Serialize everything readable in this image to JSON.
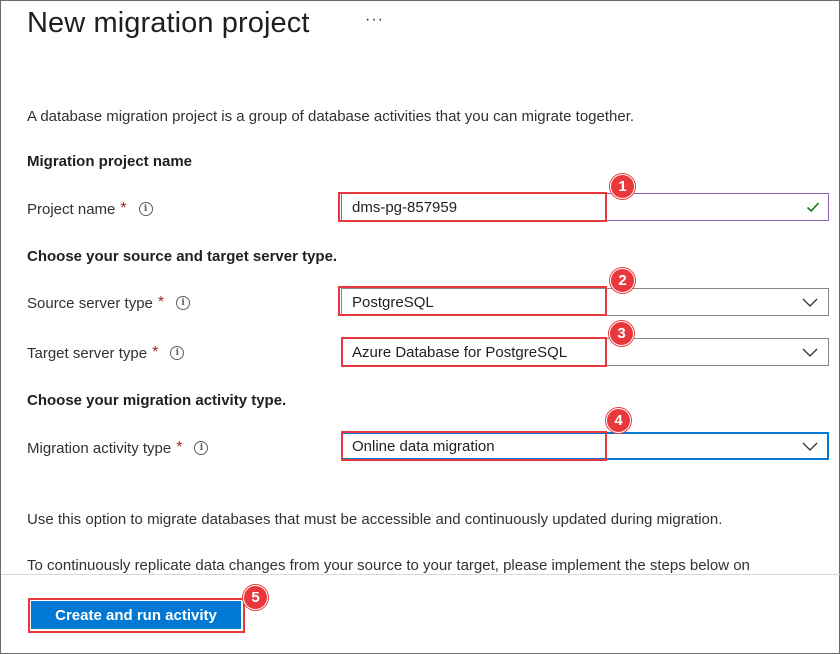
{
  "page": {
    "title": "New migration project",
    "more_menu": "···",
    "description": "A database migration project is a group of database activities that you can migrate together."
  },
  "sections": {
    "project_name_heading": "Migration project name",
    "server_type_heading": "Choose your source and target server type.",
    "activity_type_heading": "Choose your migration activity type."
  },
  "fields": {
    "project_name": {
      "label": "Project name",
      "required": "*",
      "value": "dms-pg-857959",
      "info_icon": "info-icon",
      "status_icon": "checkmark-icon"
    },
    "source_server_type": {
      "label": "Source server type",
      "required": "*",
      "value": "PostgreSQL",
      "info_icon": "info-icon"
    },
    "target_server_type": {
      "label": "Target server type",
      "required": "*",
      "value": "Azure Database for PostgreSQL",
      "info_icon": "info-icon"
    },
    "migration_activity_type": {
      "label": "Migration activity type",
      "required": "*",
      "value": "Online data migration",
      "info_icon": "info-icon"
    }
  },
  "notes": {
    "online_note": "Use this option to migrate databases that must be accessible and continuously updated during migration.",
    "replicate_note": "To continuously replicate data changes from your source to your target, please implement the steps below on"
  },
  "footer": {
    "primary_button": "Create and run activity"
  },
  "annotations": {
    "step1": "1",
    "step2": "2",
    "step3": "3",
    "step4": "4",
    "step5": "5"
  },
  "colors": {
    "accent": "#0078d4",
    "annotation_red": "#e8383d",
    "required_red": "#a4262c",
    "valid_check": "#107c10"
  }
}
